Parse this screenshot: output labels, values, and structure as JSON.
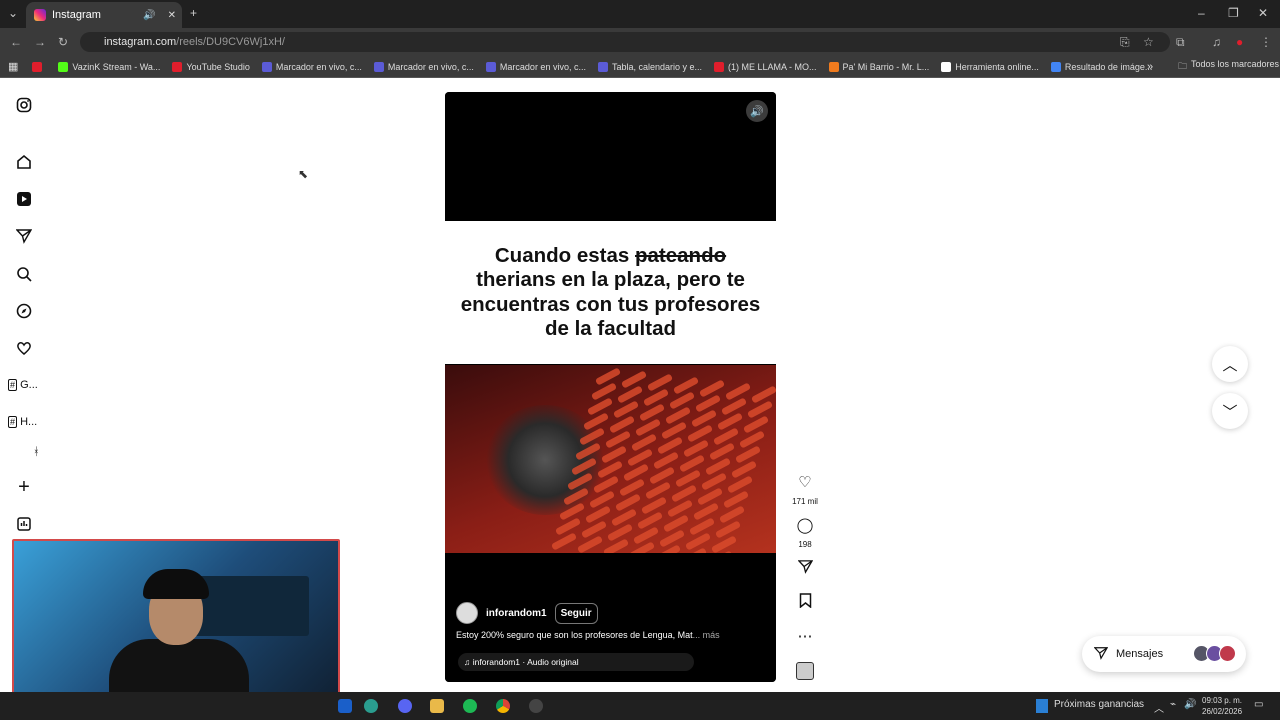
{
  "browser": {
    "tab_title": "Instagram",
    "url_host": "instagram.com",
    "url_path": "/reels/DU9CV6Wj1xH/",
    "bookmarks": [
      {
        "label": "",
        "color": "#e01e2c"
      },
      {
        "label": "VazinK Stream - Wa...",
        "color": "#53fc18"
      },
      {
        "label": "YouTube Studio",
        "color": "#e01e2c"
      },
      {
        "label": "Marcador en vivo, c...",
        "color": "#5b5bd6"
      },
      {
        "label": "Marcador en vivo, c...",
        "color": "#5b5bd6"
      },
      {
        "label": "Marcador en vivo, c...",
        "color": "#5b5bd6"
      },
      {
        "label": "Tabla, calendario y e...",
        "color": "#5b5bd6"
      },
      {
        "label": "(1) ME LLAMA - MO...",
        "color": "#e01e2c"
      },
      {
        "label": "Pa' Mi Barrio - Mr. L...",
        "color": "#f07b1e"
      },
      {
        "label": "Herramienta online...",
        "color": "#ffffff"
      },
      {
        "label": "Resultado de imáge...",
        "color": "#4285f4"
      }
    ],
    "all_bookmarks": "Todos los marcadores"
  },
  "sidebar": {
    "items": [
      {
        "icon": "instagram-icon"
      },
      {
        "icon": "home-icon"
      },
      {
        "icon": "reels-icon"
      },
      {
        "icon": "direct-icon"
      },
      {
        "icon": "search-icon"
      },
      {
        "icon": "explore-icon"
      },
      {
        "icon": "heart-icon"
      }
    ],
    "tag1": "G...",
    "tag2": "H...",
    "mark": "ᚼ"
  },
  "reel": {
    "caption_prefix": "Cuando estas",
    "caption_strike": "pateando",
    "caption_rest": "therians en la plaza, pero te encuentras con tus profesores de la facultad",
    "username": "inforandom1",
    "follow": "Seguir",
    "description": "Estoy 200% seguro que son los profesores de Lengua, Mat",
    "more": "... más",
    "audio": "inforandom1 · Audio original"
  },
  "actions": {
    "likes": "171 mil",
    "comments": "198"
  },
  "messages": {
    "label": "Mensajes"
  },
  "taskbar": {
    "news": "Próximas ganancias",
    "time": "09:03 p. m.",
    "date": "26/02/2026"
  }
}
